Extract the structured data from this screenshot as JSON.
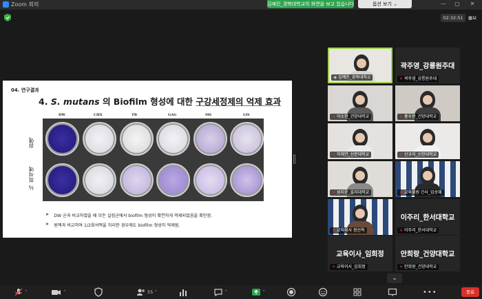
{
  "window": {
    "app_title": "Zoom 회의",
    "share_banner": "김예진_경북대학교의 화면을 보고 있습니다",
    "view_options": "옵션 보기 ⌄",
    "controls": [
      "—",
      "▢",
      "✕"
    ]
  },
  "meeting": {
    "timer": "02:32:51",
    "view_label": "보"
  },
  "slide": {
    "section": "04. 연구결과",
    "title_prefix": "4.",
    "title_species": "S. mutans",
    "title_middle": "의 Biofilm 형성에 대한",
    "title_underlined": "구강세정제의 억제 효과",
    "columns": [
      "DW",
      "CHX",
      "TB",
      "GAG",
      "MS",
      "LIS"
    ],
    "rows": [
      "원액",
      "½ 희석액"
    ],
    "bullets": [
      "DW 군과 비교하였을 때 모든 실험군에서 biofilm 형성이 확연하게 억제되었음을 확인함.",
      "원액과 비교하여 1/2희석액을 처리한 경우에도 biofilm 형성이 억제됨."
    ]
  },
  "participants": [
    {
      "name": "김예진_경북대학교",
      "video": true,
      "active": true
    },
    {
      "name": "곽주영_강릉원주대",
      "big_name": "곽주영_강릉원주대",
      "video": false
    },
    {
      "name": "이소현_건양대학교",
      "video": true
    },
    {
      "name": "홍수현_건양대학교",
      "video": true
    },
    {
      "name": "허채연_선문대학교",
      "video": true
    },
    {
      "name": "신규리_신한대학교",
      "video": true
    },
    {
      "name": "성지윤_을지대학교",
      "video": true
    },
    {
      "name": "교육위원 간사_임승혜",
      "video": true
    },
    {
      "name": "교육이사 정선옥",
      "video": true
    },
    {
      "name": "이주리_한서대학교",
      "big_name": "이주리_한서대학교",
      "video": false
    },
    {
      "name": "교육이사_임희정",
      "big_name": "교육이사_임희정",
      "video": false
    },
    {
      "name": "안희랑_건양대학교",
      "big_name": "안희랑_건양대학교",
      "video": false
    }
  ],
  "toolbar": {
    "participant_count": "55",
    "end_label": "종료"
  },
  "colors": {
    "active_speaker": "#9dd14a",
    "banner": "#2ea44f",
    "end": "#d9302c",
    "muted": "#e53935"
  }
}
